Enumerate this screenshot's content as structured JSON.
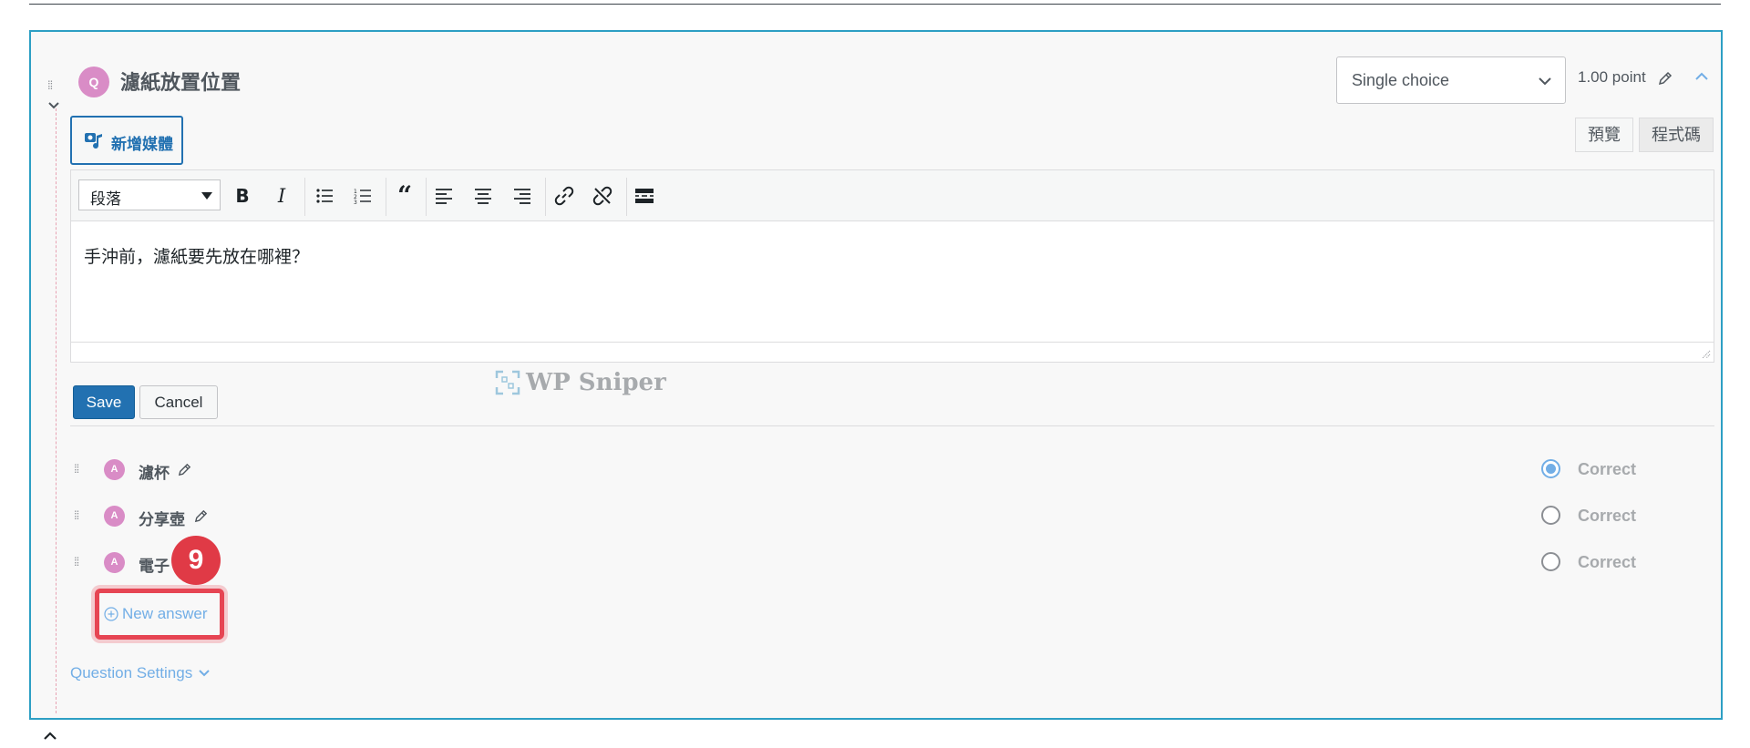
{
  "question": {
    "badge": "Q",
    "title": "濾紙放置位置",
    "type_select_value": "Single choice",
    "points": "1.00 point"
  },
  "editor": {
    "add_media_label": "新增媒體",
    "tabs": [
      "預覽",
      "程式碼"
    ],
    "format_select": "段落",
    "content": "手沖前，濾紙要先放在哪裡？",
    "toolbar_icons": [
      "bold-icon",
      "italic-icon",
      "bullet-list-icon",
      "numbered-list-icon",
      "blockquote-icon",
      "align-left-icon",
      "align-center-icon",
      "align-right-icon",
      "link-icon",
      "unlink-icon",
      "read-more-icon"
    ]
  },
  "actions": {
    "save": "Save",
    "cancel": "Cancel"
  },
  "watermark": "WP Sniper",
  "answers": [
    {
      "badge": "A",
      "text": "濾杯",
      "correct_label": "Correct",
      "checked": true
    },
    {
      "badge": "A",
      "text": "分享壺",
      "correct_label": "Correct",
      "checked": false
    },
    {
      "badge": "A",
      "text": "電子",
      "correct_label": "Correct",
      "checked": false
    }
  ],
  "new_answer": "New answer",
  "step_number": "9",
  "question_settings": "Question Settings",
  "colors": {
    "accent_blue": "#2271b1",
    "link_blue": "#72aee6",
    "panel_border": "#2d9fc4",
    "badge_pink": "#d98cc6",
    "highlight_red": "#e64553"
  }
}
